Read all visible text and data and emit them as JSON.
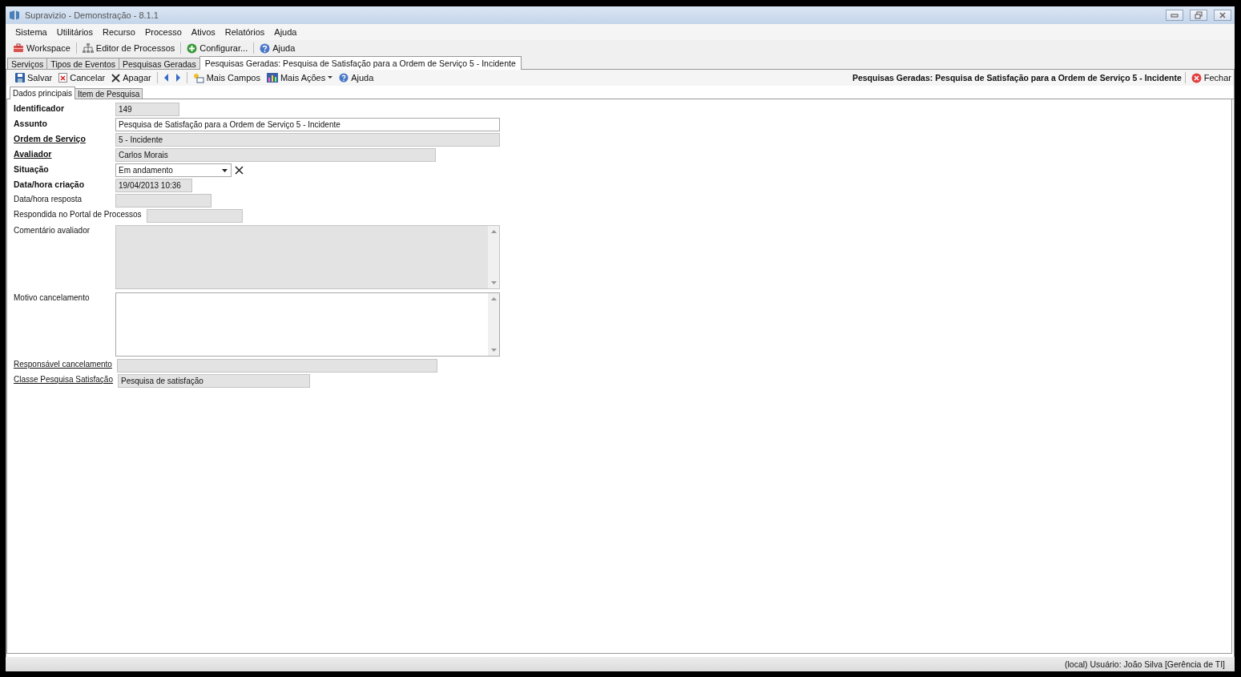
{
  "window": {
    "title": "Supravizio - Demonstração - 8.1.1"
  },
  "menu": [
    "Sistema",
    "Utilitários",
    "Recurso",
    "Processo",
    "Ativos",
    "Relatórios",
    "Ajuda"
  ],
  "toolbar": [
    {
      "kind": "workspace",
      "label": "Workspace"
    },
    {
      "kind": "editor",
      "label": "Editor de Processos"
    },
    {
      "kind": "config",
      "label": "Configurar..."
    },
    {
      "kind": "help",
      "label": "Ajuda"
    }
  ],
  "document_tabs": [
    {
      "label": "Serviços",
      "selected": false
    },
    {
      "label": "Tipos de Eventos",
      "selected": false
    },
    {
      "label": "Pesquisas Geradas",
      "selected": false
    },
    {
      "label": "Pesquisas Geradas: Pesquisa de Satisfação para a Ordem de Serviço 5 - Incidente",
      "selected": true
    }
  ],
  "actions": [
    {
      "kind": "save",
      "label": "Salvar"
    },
    {
      "kind": "cancel",
      "label": "Cancelar"
    },
    {
      "kind": "delete",
      "label": "Apagar"
    },
    {
      "kind": "prev"
    },
    {
      "kind": "next"
    },
    {
      "kind": "fields",
      "label": "Mais Campos"
    },
    {
      "kind": "more",
      "label": "Mais Ações"
    },
    {
      "kind": "help",
      "label": "Ajuda"
    }
  ],
  "document_title": "Pesquisas Geradas: Pesquisa de Satisfação para a Ordem de Serviço 5 - Incidente",
  "close_label": "Fechar",
  "form_tabs": [
    {
      "label": "Dados principais",
      "selected": true
    },
    {
      "label": "Item de Pesquisa",
      "selected": false
    }
  ],
  "fields": [
    {
      "label": "Identificador",
      "kind": "text",
      "required": true,
      "link": false,
      "readonly": true,
      "value": "149"
    },
    {
      "label": "Assunto",
      "kind": "text",
      "required": true,
      "link": false,
      "readonly": false,
      "value": "Pesquisa de Satisfação para a Ordem de Serviço 5 - Incidente"
    },
    {
      "label": "Ordem de Serviço",
      "kind": "text",
      "required": true,
      "link": true,
      "readonly": true,
      "value": "5 - Incidente"
    },
    {
      "label": "Avaliador",
      "kind": "text",
      "required": true,
      "link": true,
      "readonly": true,
      "value": "Carlos Morais"
    },
    {
      "label": "Situação",
      "kind": "combo",
      "required": true,
      "link": false,
      "readonly": false,
      "value": "Em andamento"
    },
    {
      "label": "Data/hora criação",
      "kind": "text",
      "required": true,
      "link": false,
      "readonly": true,
      "value": "19/04/2013 10:36"
    },
    {
      "label": "Data/hora resposta",
      "kind": "text",
      "required": false,
      "link": false,
      "readonly": true
    },
    {
      "label": "Respondida no Portal de Processos",
      "kind": "text",
      "required": false,
      "link": false,
      "readonly": true
    },
    {
      "label": "Comentário avaliador",
      "kind": "memo",
      "required": false,
      "link": false,
      "readonly": true
    },
    {
      "label": "Motivo cancelamento",
      "kind": "memo",
      "required": false,
      "link": false,
      "readonly": false
    },
    {
      "label": "Responsável cancelamento",
      "kind": "text",
      "required": false,
      "link": true,
      "readonly": true
    },
    {
      "label": "Classe Pesquisa Satisfação",
      "kind": "text",
      "required": false,
      "link": true,
      "readonly": true,
      "value": "Pesquisa de satisfação"
    }
  ],
  "status_bar": "(local)  Usuário: João Silva [Gerência de TI]"
}
